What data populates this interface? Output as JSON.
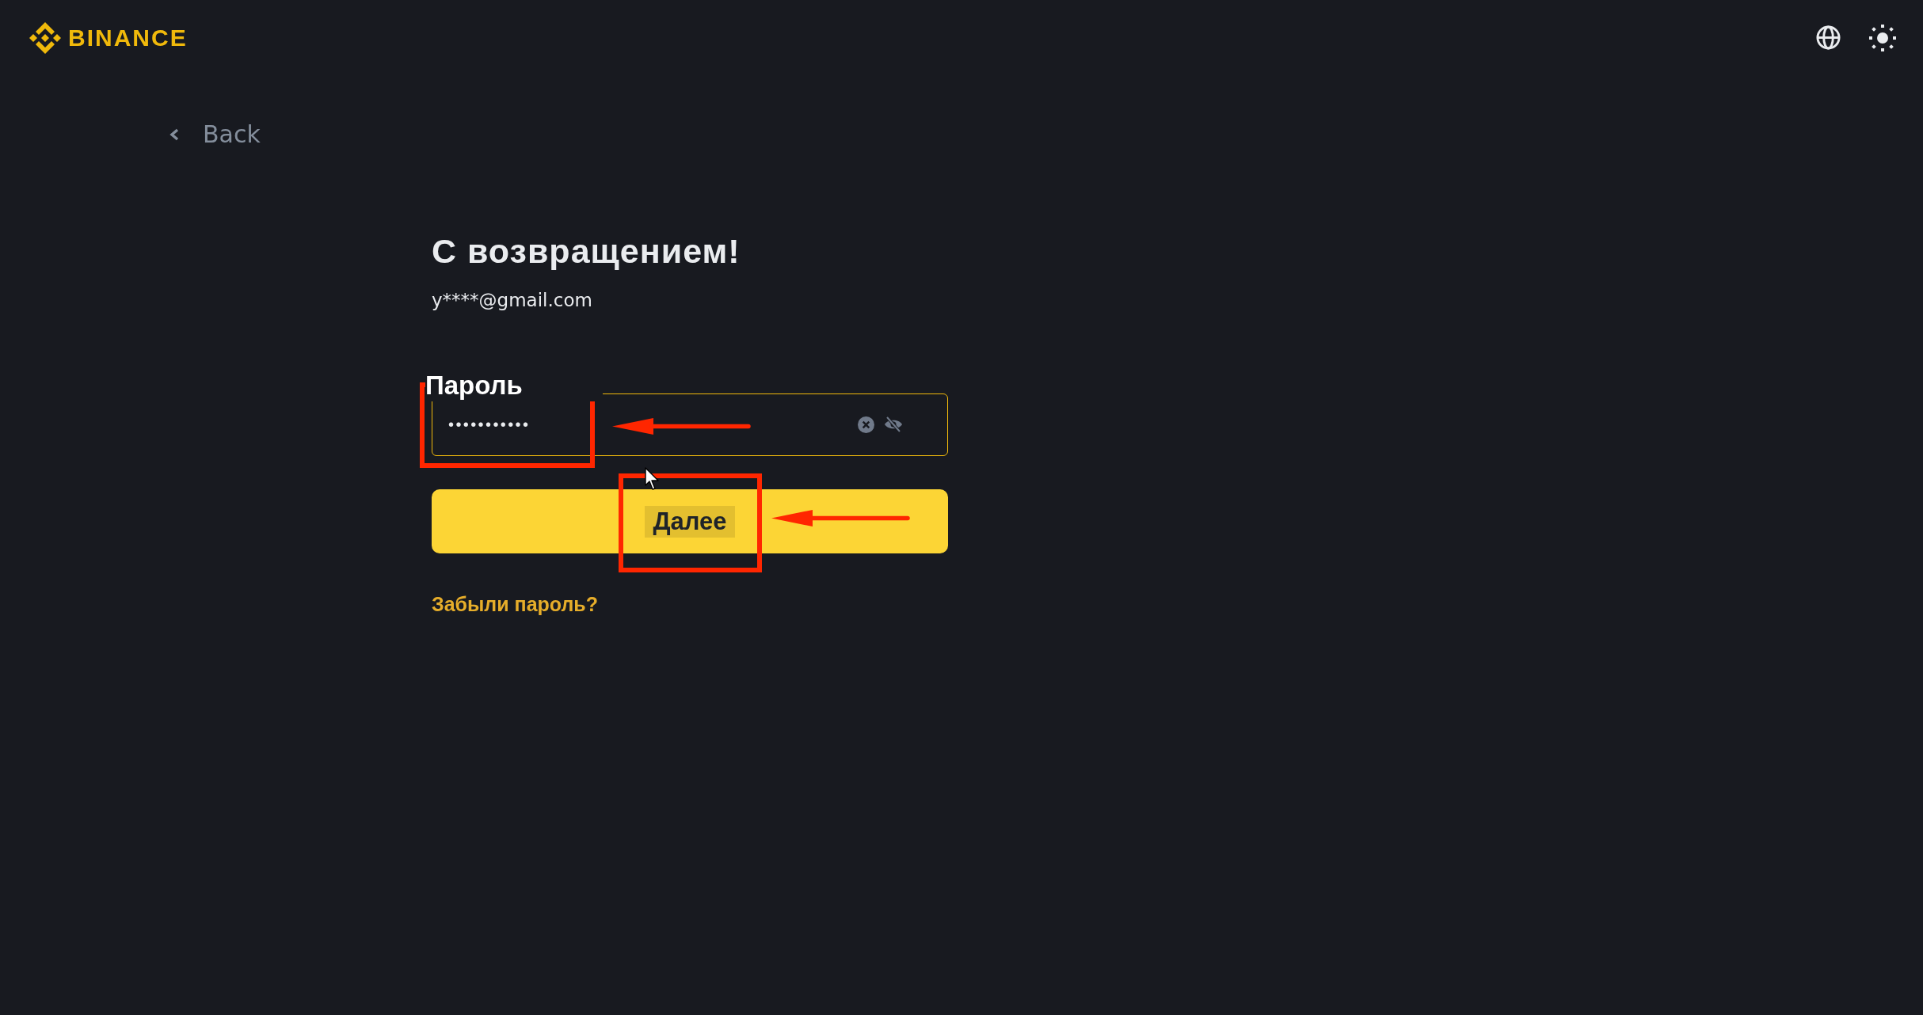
{
  "header": {
    "logo_text": "BINANCE"
  },
  "back_link": {
    "label": "Back"
  },
  "form": {
    "title": "С возвращением!",
    "email": "y****@gmail.com",
    "password": {
      "label": "Пароль",
      "value": "•••••••••••",
      "focused": true
    },
    "submit": {
      "label": "Далее",
      "label_highlighted": true
    },
    "forgot_link": "Забыли пароль?"
  },
  "annotations": [
    {
      "kind": "box"
    },
    {
      "kind": "arrow"
    },
    {
      "kind": "box"
    },
    {
      "kind": "arrow"
    }
  ]
}
